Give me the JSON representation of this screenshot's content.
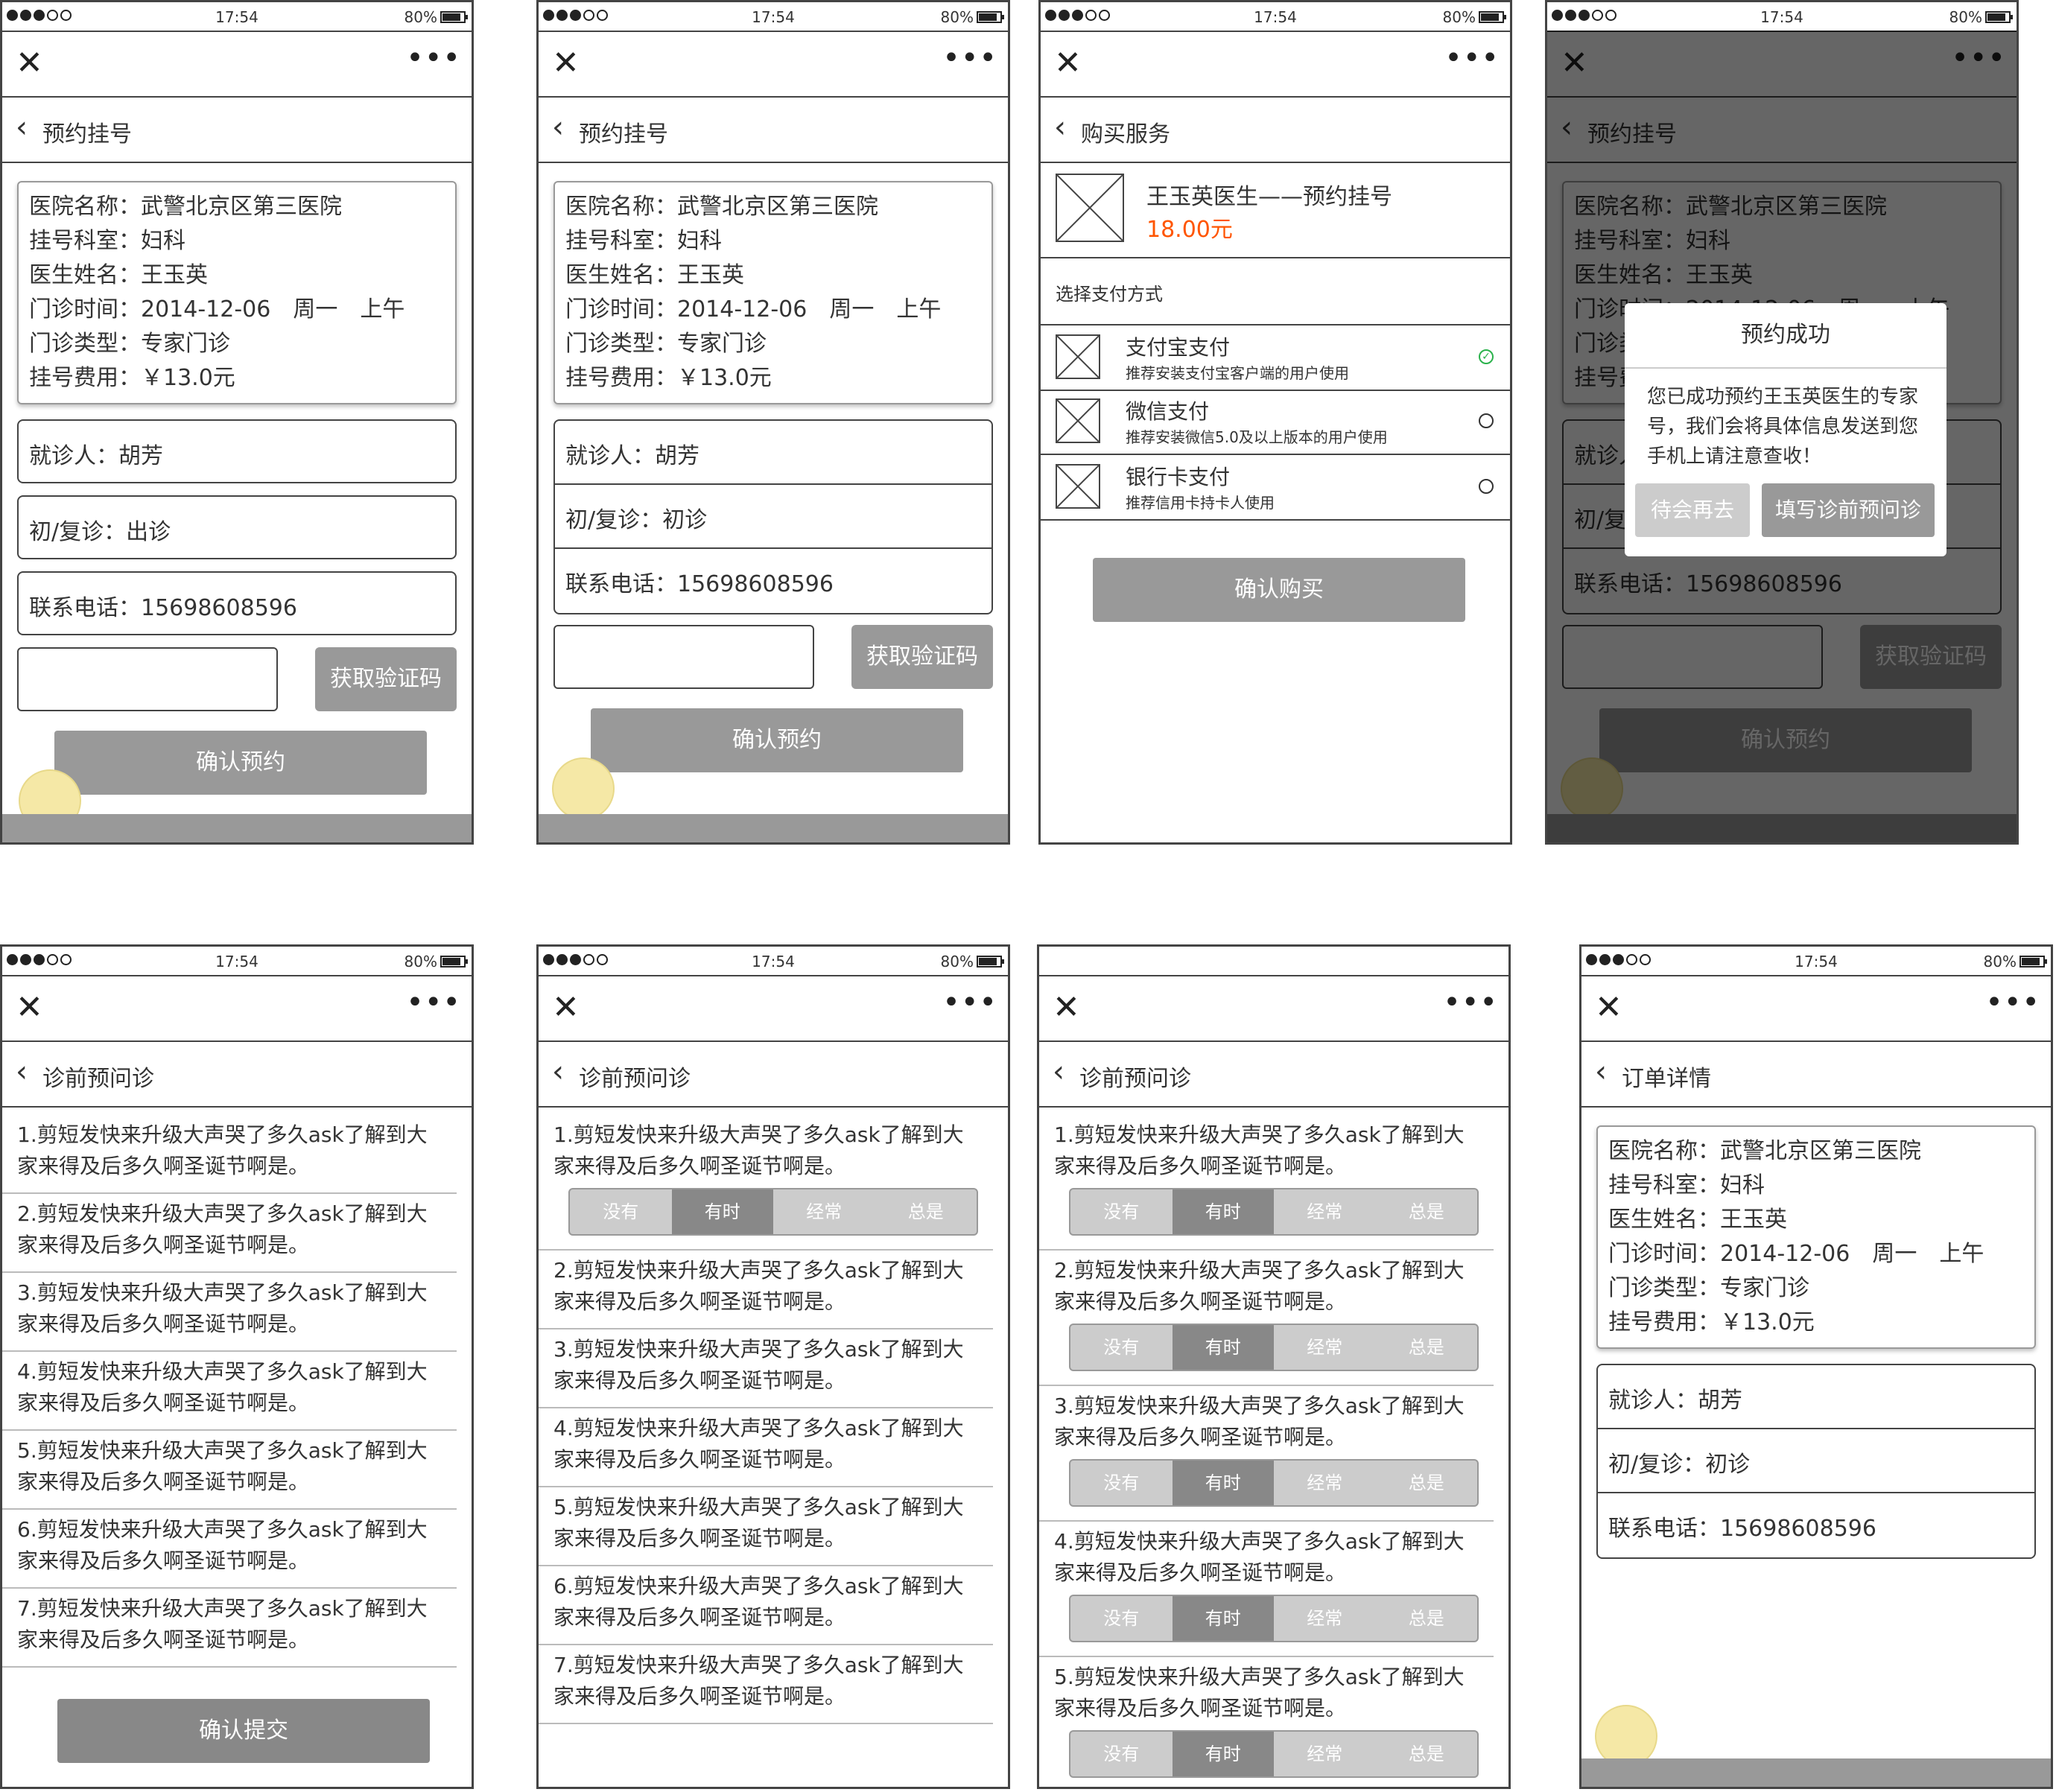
{
  "status": {
    "time": "17:54",
    "battery": "80%"
  },
  "booking": {
    "title": "预约挂号",
    "info": [
      "医院名称：武警北京区第三医院",
      "挂号科室：妇科",
      "医生姓名：王玉英",
      "门诊时间：2014-12-06　周一　上午",
      "门诊类型：专家门诊",
      "挂号费用：￥13.0元"
    ],
    "patient": "就诊人：胡芳",
    "visit_type_a": "初/复诊：出诊",
    "visit_type_b": "初/复诊：初诊",
    "phone": "联系电话：15698608596",
    "code_button": "获取验证码",
    "confirm": "确认预约"
  },
  "purchase": {
    "title": "购买服务",
    "product_name": "王玉英医生——预约挂号",
    "price": "18.00元",
    "choose_label": "选择支付方式",
    "methods": [
      {
        "name": "支付宝支付",
        "desc": "推荐安装支付宝客户端的用户使用"
      },
      {
        "name": "微信支付",
        "desc": "推荐安装微信5.0及以上版本的用户使用"
      },
      {
        "name": "银行卡支付",
        "desc": "推荐信用卡持卡人使用"
      }
    ],
    "confirm": "确认购买"
  },
  "modal": {
    "title": "预约成功",
    "text": "您已成功预约王玉英医生的专家号，我们会将具体信息发送到您手机上请注意查收！",
    "later": "待会再去",
    "fill": "填写诊前预问诊"
  },
  "survey": {
    "title": "诊前预问诊",
    "questions": [
      "1.剪短发快来升级大声哭了多久ask了解到大家来得及后多久啊圣诞节啊是。",
      "2.剪短发快来升级大声哭了多久ask了解到大家来得及后多久啊圣诞节啊是。",
      "3.剪短发快来升级大声哭了多久ask了解到大家来得及后多久啊圣诞节啊是。",
      "4.剪短发快来升级大声哭了多久ask了解到大家来得及后多久啊圣诞节啊是。",
      "5.剪短发快来升级大声哭了多久ask了解到大家来得及后多久啊圣诞节啊是。",
      "6.剪短发快来升级大声哭了多久ask了解到大家来得及后多久啊圣诞节啊是。",
      "7.剪短发快来升级大声哭了多久ask了解到大家来得及后多久啊圣诞节啊是。"
    ],
    "options": [
      "没有",
      "有时",
      "经常",
      "总是"
    ],
    "submit": "确认提交"
  },
  "order": {
    "title": "订单详情"
  },
  "icons": {
    "close": "close-icon",
    "more": "more-icon",
    "back": "chevron-left-icon",
    "placeholder": "image-placeholder-icon"
  }
}
